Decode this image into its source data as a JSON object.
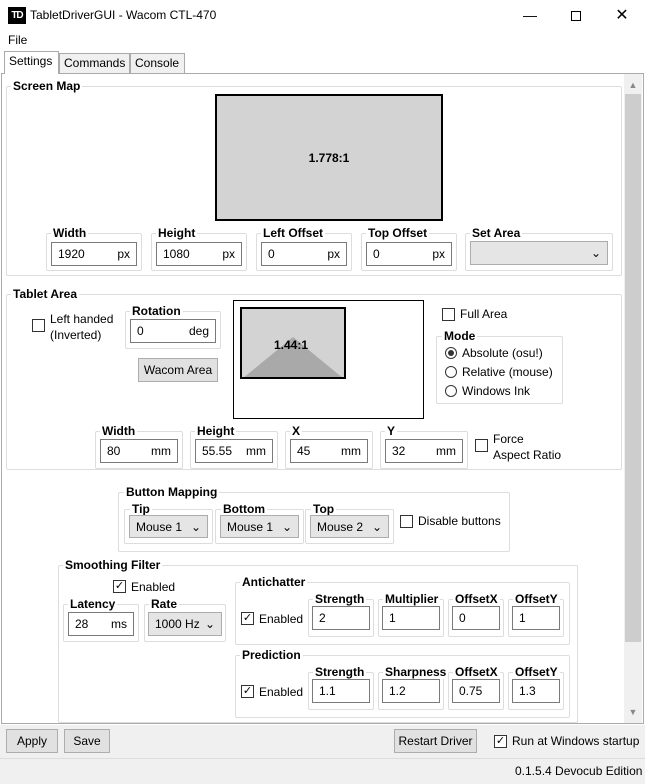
{
  "window": {
    "title": "TabletDriverGUI - Wacom CTL-470",
    "logo": "TD",
    "minimize_icon": "minimize-icon",
    "maximize_icon": "maximize-icon",
    "close_icon": "close-icon"
  },
  "menu": {
    "file": "File"
  },
  "tabs": [
    {
      "label": "Settings"
    },
    {
      "label": "Commands"
    },
    {
      "label": "Console"
    }
  ],
  "screen_map": {
    "title": "Screen Map",
    "ratio": "1.778:1",
    "width": {
      "label": "Width",
      "value": "1920",
      "unit": "px"
    },
    "height": {
      "label": "Height",
      "value": "1080",
      "unit": "px"
    },
    "left_offset": {
      "label": "Left Offset",
      "value": "0",
      "unit": "px"
    },
    "top_offset": {
      "label": "Top Offset",
      "value": "0",
      "unit": "px"
    },
    "set_area": {
      "label": "Set Area",
      "value": ""
    }
  },
  "tablet_area": {
    "title": "Tablet Area",
    "left_handed": "Left handed (Inverted)",
    "rotation": {
      "label": "Rotation",
      "value": "0",
      "unit": "deg"
    },
    "wacom_area": "Wacom Area",
    "ratio": "1.44:1",
    "full_area": "Full Area",
    "mode": {
      "label": "Mode",
      "options": [
        "Absolute (osu!)",
        "Relative (mouse)",
        "Windows Ink"
      ],
      "selected": "Absolute (osu!)"
    },
    "width": {
      "label": "Width",
      "value": "80",
      "unit": "mm"
    },
    "height": {
      "label": "Height",
      "value": "55.55",
      "unit": "mm"
    },
    "x": {
      "label": "X",
      "value": "45",
      "unit": "mm"
    },
    "y": {
      "label": "Y",
      "value": "32",
      "unit": "mm"
    },
    "force_aspect": "Force Aspect Ratio"
  },
  "button_mapping": {
    "title": "Button Mapping",
    "tip": {
      "label": "Tip",
      "value": "Mouse 1"
    },
    "bottom": {
      "label": "Bottom",
      "value": "Mouse 1"
    },
    "top": {
      "label": "Top",
      "value": "Mouse 2"
    },
    "disable": "Disable buttons"
  },
  "smoothing": {
    "title": "Smoothing Filter",
    "enabled": "Enabled",
    "latency": {
      "label": "Latency",
      "value": "28",
      "unit": "ms"
    },
    "rate": {
      "label": "Rate",
      "value": "1000 Hz"
    },
    "antichatter": {
      "title": "Antichatter",
      "enabled": "Enabled",
      "strength": {
        "label": "Strength",
        "value": "2"
      },
      "multiplier": {
        "label": "Multiplier",
        "value": "1"
      },
      "offsetx": {
        "label": "OffsetX",
        "value": "0"
      },
      "offsety": {
        "label": "OffsetY",
        "value": "1"
      }
    },
    "prediction": {
      "title": "Prediction",
      "enabled": "Enabled",
      "strength": {
        "label": "Strength",
        "value": "1.1"
      },
      "sharpness": {
        "label": "Sharpness",
        "value": "1.2"
      },
      "offsetx": {
        "label": "OffsetX",
        "value": "0.75"
      },
      "offsety": {
        "label": "OffsetY",
        "value": "1.3"
      }
    }
  },
  "footer": {
    "apply": "Apply",
    "save": "Save",
    "restart": "Restart Driver",
    "run_startup": "Run at Windows startup",
    "version": "0.1.5.4 Devocub Edition"
  },
  "checkmark": "✓",
  "dropdown_arrow": "⌄"
}
